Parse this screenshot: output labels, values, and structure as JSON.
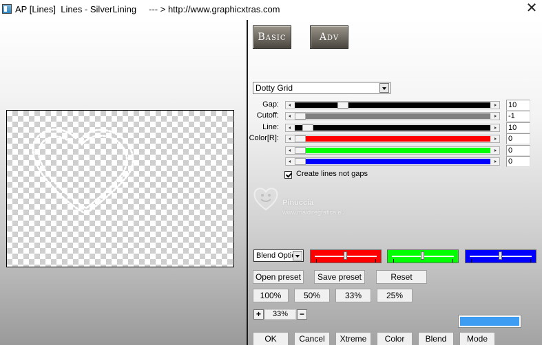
{
  "window": {
    "title": "AP [Lines]  Lines - SilverLining     --- > http://www.graphicxtras.com",
    "close_glyph": "✕"
  },
  "tabs": [
    {
      "label": "Basic"
    },
    {
      "label": "Adv"
    }
  ],
  "mode_select": {
    "value": "Dotty Grid"
  },
  "params": [
    {
      "label": "Gap:",
      "value": "10",
      "level": 0.23,
      "track_color": "#000000"
    },
    {
      "label": "Cutoff:",
      "value": "-1",
      "level": 0.0,
      "track_color": "#808080"
    },
    {
      "label": "Line:",
      "value": "10",
      "level": 0.04,
      "track_color": "#000000"
    },
    {
      "label": "Color[R]:",
      "value": "0",
      "level": 0.0,
      "track_color": "#ff0000"
    },
    {
      "label": "",
      "value": "0",
      "level": 0.0,
      "track_color": "#00ff00"
    },
    {
      "label": "",
      "value": "0",
      "level": 0.0,
      "track_color": "#0000ff"
    }
  ],
  "checkbox": {
    "label": "Create lines not gaps",
    "checked": true
  },
  "watermark": {
    "name": "Pinuccia",
    "url": "www.maidiregrafica.eu"
  },
  "blend": {
    "value": "Blend Optio"
  },
  "color_sliders": [
    {
      "color": "#ff0000",
      "level": 0.5
    },
    {
      "color": "#00ff00",
      "level": 0.5
    },
    {
      "color": "#0000ff",
      "level": 0.5
    }
  ],
  "preset_buttons": {
    "open": "Open preset",
    "save": "Save preset",
    "reset": "Reset"
  },
  "zoom_buttons": [
    "100%",
    "50%",
    "33%",
    "25%"
  ],
  "zoom": {
    "plus": "+",
    "value": "33%",
    "minus": "−"
  },
  "swatch_color": "#3d9df2",
  "bottom_buttons": [
    "OK",
    "Cancel",
    "Xtreme",
    "Color",
    "Blend",
    "Mode"
  ]
}
